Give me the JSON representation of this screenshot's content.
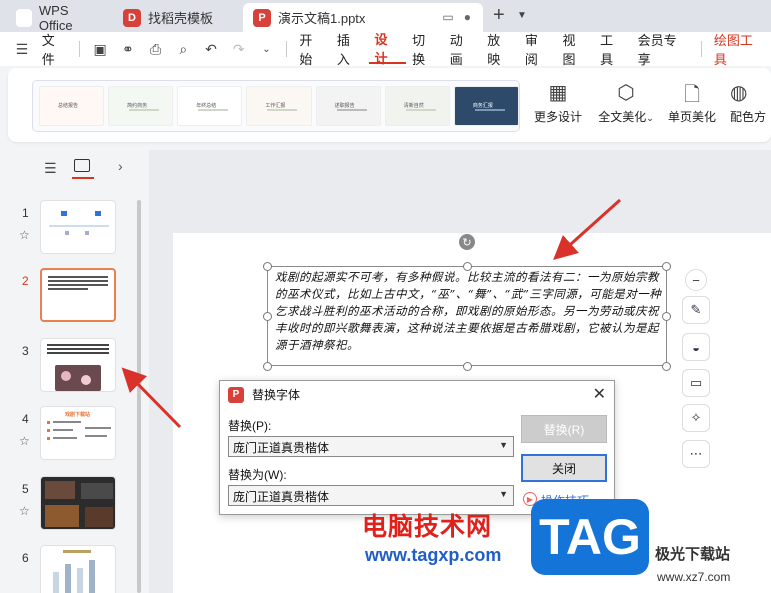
{
  "tabs": [
    {
      "label": "WPS Office",
      "icon": "wps-logo-icon"
    },
    {
      "label": "找稻壳模板",
      "icon": "docer-icon"
    },
    {
      "label": "演示文稿1.pptx",
      "icon": "ppt-file-icon"
    }
  ],
  "menubar": {
    "file": "文件",
    "items": [
      "开始",
      "插入",
      "设计",
      "切换",
      "动画",
      "放映",
      "审阅",
      "视图",
      "工具",
      "会员专享"
    ],
    "active": "设计",
    "draw_tools": "绘图工具"
  },
  "ribbon": {
    "templates": [
      "总结报告",
      "简约商务",
      "年终总结",
      "工作汇报",
      "述职报告",
      "清新自然",
      "商务汇报"
    ],
    "more_design": "更多设计",
    "full_beautify": "全文美化",
    "single_beautify": "单页美化",
    "color_scheme": "配色方"
  },
  "slides": [
    {
      "num": "1",
      "starred": true
    },
    {
      "num": "2",
      "starred": false,
      "active": true
    },
    {
      "num": "3",
      "starred": false
    },
    {
      "num": "4",
      "starred": true
    },
    {
      "num": "5",
      "starred": true
    },
    {
      "num": "6",
      "starred": false
    }
  ],
  "slide4_title": "戏剧下载站",
  "textbox": {
    "text": "戏剧的起源实不可考，有多种假说。比较主流的看法有二：一为原始宗教的巫术仪式，比如上古中文，“巫”、“舞”、“武”三字同源，可能是对一种乞求战斗胜利的巫术活动的合称，即戏剧的原始形态。另一为劳动或庆祝丰收时的即兴歌舞表演，这种说法主要依据是古希腊戏剧，它被认为是起源于酒神祭祀。"
  },
  "dialog": {
    "title": "替换字体",
    "replace_label": "替换(P):",
    "replace_value": "庞门正道真贵楷体",
    "replace_with_label": "替换为(W):",
    "replace_with_value": "庞门正道真贵楷体",
    "replace_button": "替换(R)",
    "close_button": "关闭",
    "tips_link": "操作技巧"
  },
  "watermark": {
    "site_cn": "电脑技术网",
    "site_url": "www.tagxp.com",
    "tag": "TAG",
    "right_cn": "极光下载站",
    "right_url": "www.xz7.com"
  },
  "colors": {
    "accent": "#d6361f",
    "arrow": "#d9322b",
    "link": "#2f73d4"
  }
}
